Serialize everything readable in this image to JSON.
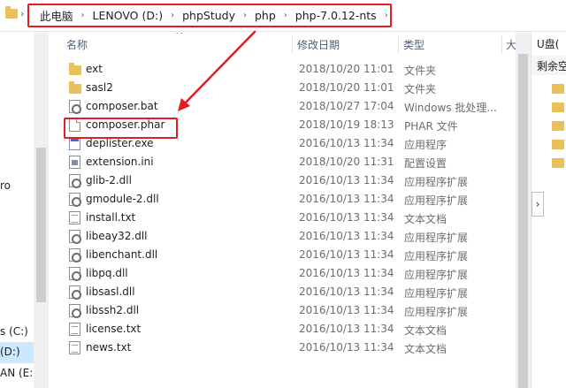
{
  "breadcrumb": [
    "此电脑",
    "LENOVO (D:)",
    "phpStudy",
    "php",
    "php-7.0.12-nts"
  ],
  "columns": {
    "name": "名称",
    "date": "修改日期",
    "type": "类型",
    "size": "大"
  },
  "files": [
    {
      "name": "ext",
      "date": "2018/10/20 11:01",
      "type": "文件夹",
      "icon": "folder-icon"
    },
    {
      "name": "sasl2",
      "date": "2018/10/20 11:01",
      "type": "文件夹",
      "icon": "folder-icon"
    },
    {
      "name": "composer.bat",
      "date": "2018/10/27 17:04",
      "type": "Windows 批处理...",
      "icon": "batch-file-icon"
    },
    {
      "name": "composer.phar",
      "date": "2018/10/19 18:13",
      "type": "PHAR 文件",
      "icon": "file-icon"
    },
    {
      "name": "deplister.exe",
      "date": "2016/10/13 11:34",
      "type": "应用程序",
      "icon": "exe-icon"
    },
    {
      "name": "extension.ini",
      "date": "2018/10/20 11:31",
      "type": "配置设置",
      "icon": "ini-icon"
    },
    {
      "name": "glib-2.dll",
      "date": "2016/10/13 11:34",
      "type": "应用程序扩展",
      "icon": "dll-icon"
    },
    {
      "name": "gmodule-2.dll",
      "date": "2016/10/13 11:34",
      "type": "应用程序扩展",
      "icon": "dll-icon"
    },
    {
      "name": "install.txt",
      "date": "2016/10/13 11:34",
      "type": "文本文档",
      "icon": "text-file-icon"
    },
    {
      "name": "libeay32.dll",
      "date": "2016/10/13 11:34",
      "type": "应用程序扩展",
      "icon": "dll-icon"
    },
    {
      "name": "libenchant.dll",
      "date": "2016/10/13 11:34",
      "type": "应用程序扩展",
      "icon": "dll-icon"
    },
    {
      "name": "libpq.dll",
      "date": "2016/10/13 11:34",
      "type": "应用程序扩展",
      "icon": "dll-icon"
    },
    {
      "name": "libsasl.dll",
      "date": "2016/10/13 11:34",
      "type": "应用程序扩展",
      "icon": "dll-icon"
    },
    {
      "name": "libssh2.dll",
      "date": "2016/10/13 11:34",
      "type": "应用程序扩展",
      "icon": "dll-icon"
    },
    {
      "name": "license.txt",
      "date": "2016/10/13 11:34",
      "type": "文本文档",
      "icon": "text-file-icon"
    },
    {
      "name": "news.txt",
      "date": "2016/10/13 11:34",
      "type": "文本文档",
      "icon": "text-file-icon"
    }
  ],
  "nav": {
    "item_ro": "ro",
    "drive_c": "s (C:)",
    "drive_d": "(D:)",
    "drive_e": "AN (E:)"
  },
  "right_pane": {
    "title": "U盘(",
    "subtitle": "剩余空"
  },
  "annotation_color": "#e51c23"
}
